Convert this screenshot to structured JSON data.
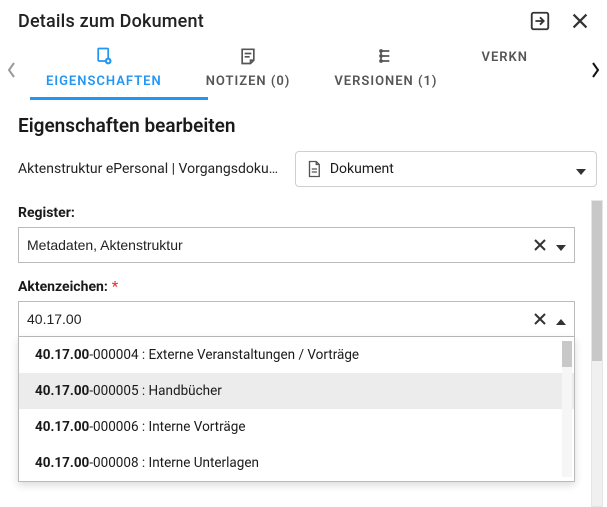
{
  "header": {
    "title": "Details zum Dokument"
  },
  "tabs": {
    "items": [
      {
        "label": "EIGENSCHAFTEN",
        "icon": "properties"
      },
      {
        "label": "NOTIZEN (0)",
        "icon": "note"
      },
      {
        "label": "VERSIONEN (1)",
        "icon": "versions"
      },
      {
        "label": "VERKN",
        "icon": ""
      }
    ]
  },
  "section_title": "Eigenschaften bearbeiten",
  "crumb": "Aktenstruktur ePersonal | Vorgangsdoku…",
  "doc_select": {
    "label": "Dokument"
  },
  "register": {
    "label": "Register:",
    "value": "Metadaten, Aktenstruktur"
  },
  "aktenzeichen": {
    "label": "Aktenzeichen:",
    "value": "40.17.00",
    "options": [
      {
        "prefix": "40.17.00",
        "code": "-000004",
        "desc": "Externe Veranstaltungen / Vorträge"
      },
      {
        "prefix": "40.17.00",
        "code": "-000005",
        "desc": "Handbücher"
      },
      {
        "prefix": "40.17.00",
        "code": "-000006",
        "desc": "Interne Vorträge"
      },
      {
        "prefix": "40.17.00",
        "code": "-000008",
        "desc": "Interne Unterlagen"
      }
    ],
    "hover_index": 1
  }
}
